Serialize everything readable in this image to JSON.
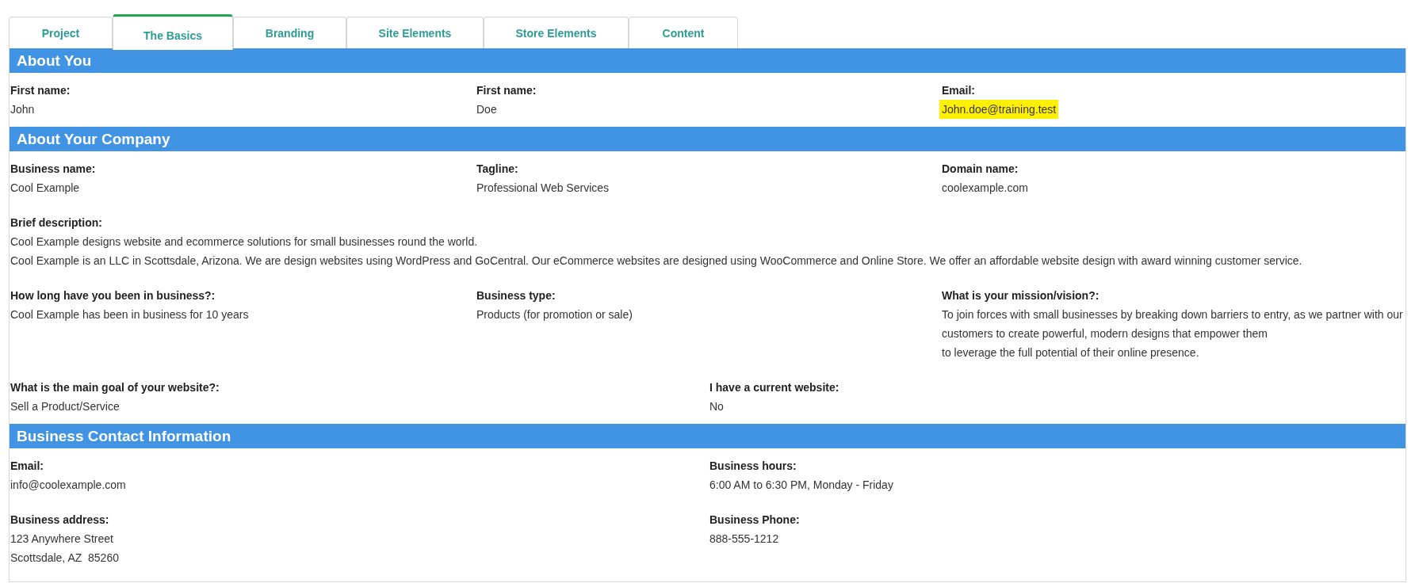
{
  "tabs": [
    {
      "label": "Project",
      "selected": false
    },
    {
      "label": "The Basics",
      "selected": true
    },
    {
      "label": "Branding",
      "selected": false
    },
    {
      "label": "Site Elements",
      "selected": false
    },
    {
      "label": "Store Elements",
      "selected": false
    },
    {
      "label": "Content",
      "selected": false
    }
  ],
  "sections": [
    {
      "title": "About You",
      "rows": [
        {
          "kind": "thirds",
          "fields": [
            {
              "label": "First name:",
              "lines": [
                "John"
              ],
              "highlighted": false
            },
            {
              "label": "First name:",
              "lines": [
                "Doe"
              ],
              "highlighted": false
            },
            {
              "label": "Email:",
              "lines": [
                "John.doe@training.test"
              ],
              "highlighted": true
            }
          ]
        }
      ]
    },
    {
      "title": "About Your Company",
      "rows": [
        {
          "kind": "thirds",
          "fields": [
            {
              "label": "Business name:",
              "lines": [
                "Cool Example"
              ],
              "highlighted": false
            },
            {
              "label": "Tagline:",
              "lines": [
                "Professional Web Services"
              ],
              "highlighted": false
            },
            {
              "label": "Domain name:",
              "lines": [
                "coolexample.com"
              ],
              "highlighted": false
            }
          ]
        },
        {
          "kind": "full",
          "fields": [
            {
              "label": "Brief description:",
              "lines": [
                "Cool Example designs website and ecommerce solutions for small businesses round the world.",
                "Cool Example is an LLC in Scottsdale, Arizona. We are design websites using WordPress and GoCentral. Our eCommerce websites are designed using WooCommerce and Online Store. We offer an affordable website design with award winning customer service."
              ],
              "highlighted": false
            }
          ]
        },
        {
          "kind": "thirds",
          "fields": [
            {
              "label": "How long have you been in business?:",
              "lines": [
                "Cool Example has been in business for 10 years"
              ],
              "highlighted": false
            },
            {
              "label": "Business type:",
              "lines": [
                "Products (for promotion or sale)"
              ],
              "highlighted": false
            },
            {
              "label": "What is your mission/vision?:",
              "lines": [
                "To join forces with small businesses by breaking down barriers to entry, as we partner with our customers to create powerful, modern designs that empower them",
                "to leverage the full potential of their online presence."
              ],
              "highlighted": false
            }
          ]
        },
        {
          "kind": "halves",
          "fields": [
            {
              "label": "What is the main goal of your website?:",
              "lines": [
                "Sell a Product/Service"
              ],
              "highlighted": false
            },
            {
              "label": "I have a current website:",
              "lines": [
                "No"
              ],
              "highlighted": false
            }
          ]
        }
      ]
    },
    {
      "title": "Business Contact Information",
      "rows": [
        {
          "kind": "halves",
          "fields": [
            {
              "label": "Email:",
              "lines": [
                "info@coolexample.com"
              ],
              "highlighted": false
            },
            {
              "label": "Business hours:",
              "lines": [
                "6:00 AM to 6:30 PM, Monday - Friday"
              ],
              "highlighted": false
            }
          ]
        },
        {
          "kind": "halves",
          "fields": [
            {
              "label": "Business address:",
              "lines": [
                "123 Anywhere Street",
                "Scottsdale, AZ  85260"
              ],
              "highlighted": false
            },
            {
              "label": "Business Phone:",
              "lines": [
                "888-555-1212"
              ],
              "highlighted": false
            }
          ]
        }
      ]
    }
  ]
}
